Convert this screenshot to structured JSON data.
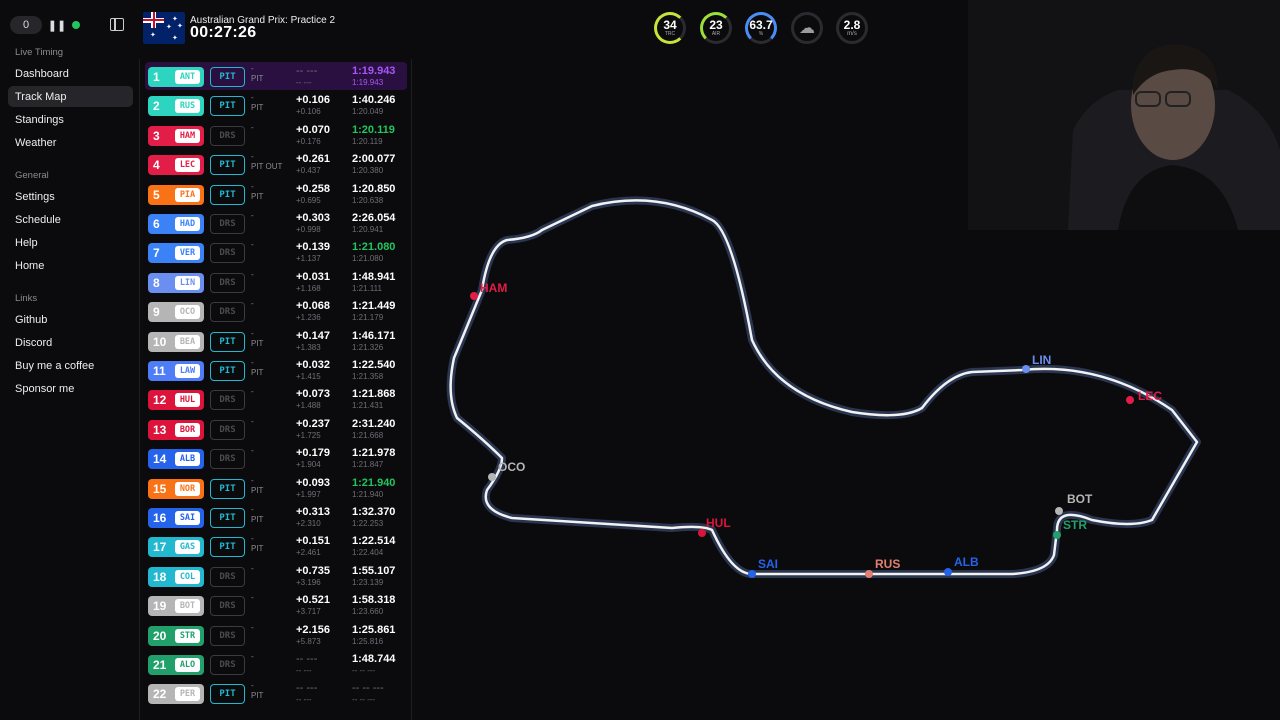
{
  "app": {
    "counter": "0",
    "colors": {
      "accent_purple": "#a855f7",
      "fastest_green": "#22c55e",
      "pit_cyan": "#22b8cf",
      "live_green": "#22c55e"
    }
  },
  "sidebar": {
    "sections": [
      {
        "heading": "Live Timing",
        "items": [
          "Dashboard",
          "Track Map",
          "Standings",
          "Weather"
        ]
      },
      {
        "heading": "General",
        "items": [
          "Settings",
          "Schedule",
          "Help",
          "Home"
        ]
      },
      {
        "heading": "Links",
        "items": [
          "Github",
          "Discord",
          "Buy me a coffee",
          "Sponsor me"
        ]
      }
    ],
    "active_item": "Track Map"
  },
  "header": {
    "session_title": "Australian Grand Prix: Practice 2",
    "clock": "00:27:26",
    "flag_icon": "australia-flag-icon"
  },
  "weather": {
    "track_temp": {
      "value": "34",
      "label": "TRC",
      "color": "#c6e33b"
    },
    "air_temp": {
      "value": "23",
      "label": "AIR",
      "color": "#9be03b"
    },
    "humidity": {
      "value": "63.7",
      "label": "%",
      "color": "#4b8df7"
    },
    "rain_icon": "rain-cloud-icon",
    "wind": {
      "value": "2.8",
      "label": "m/s"
    }
  },
  "drivers": [
    {
      "pos": "1",
      "code": "ANT",
      "color": "#2dd4bf",
      "drs": "PIT",
      "status": "-",
      "status2": "PIT",
      "gap": "-- ---",
      "interval": "-- ---",
      "lap": "1:19.943",
      "prev": "1:19.943",
      "lap_color": "purple",
      "fastest": true
    },
    {
      "pos": "2",
      "code": "RUS",
      "color": "#2dd4bf",
      "drs": "PIT",
      "status": "-",
      "status2": "PIT",
      "gap": "+0.106",
      "interval": "+0.106",
      "lap": "1:40.246",
      "prev": "1:20.049",
      "lap_color": "white"
    },
    {
      "pos": "3",
      "code": "HAM",
      "color": "#e11d48",
      "drs": "DRS",
      "status": "-",
      "status2": "-",
      "gap": "+0.070",
      "interval": "+0.176",
      "lap": "1:20.119",
      "prev": "1:20.119",
      "lap_color": "green"
    },
    {
      "pos": "4",
      "code": "LEC",
      "color": "#e11d48",
      "drs": "PIT",
      "status": "-",
      "status2": "PIT OUT",
      "gap": "+0.261",
      "interval": "+0.437",
      "lap": "2:00.077",
      "prev": "1:20.380",
      "lap_color": "white"
    },
    {
      "pos": "5",
      "code": "PIA",
      "color": "#f97316",
      "drs": "PIT",
      "status": "-",
      "status2": "PIT",
      "gap": "+0.258",
      "interval": "+0.695",
      "lap": "1:20.850",
      "prev": "1:20.638",
      "lap_color": "white"
    },
    {
      "pos": "6",
      "code": "HAD",
      "color": "#3b82f6",
      "drs": "DRS",
      "status": "-",
      "status2": "-",
      "gap": "+0.303",
      "interval": "+0.998",
      "lap": "2:26.054",
      "prev": "1:20.941",
      "lap_color": "white"
    },
    {
      "pos": "7",
      "code": "VER",
      "color": "#3b82f6",
      "drs": "DRS",
      "status": "-",
      "status2": "-",
      "gap": "+0.139",
      "interval": "+1.137",
      "lap": "1:21.080",
      "prev": "1:21.080",
      "lap_color": "green"
    },
    {
      "pos": "8",
      "code": "LIN",
      "color": "#6b8ff0",
      "drs": "DRS",
      "status": "-",
      "status2": "-",
      "gap": "+0.031",
      "interval": "+1.168",
      "lap": "1:48.941",
      "prev": "1:21.111",
      "lap_color": "white"
    },
    {
      "pos": "9",
      "code": "OCO",
      "color": "#b5b5b5",
      "drs": "DRS",
      "status": "-",
      "status2": "-",
      "gap": "+0.068",
      "interval": "+1.236",
      "lap": "1:21.449",
      "prev": "1:21.179",
      "lap_color": "white"
    },
    {
      "pos": "10",
      "code": "BEA",
      "color": "#b5b5b5",
      "drs": "PIT",
      "status": "-",
      "status2": "PIT",
      "gap": "+0.147",
      "interval": "+1.383",
      "lap": "1:46.171",
      "prev": "1:21.326",
      "lap_color": "white"
    },
    {
      "pos": "11",
      "code": "LAW",
      "color": "#4f7cf7",
      "drs": "PIT",
      "status": "-",
      "status2": "PIT",
      "gap": "+0.032",
      "interval": "+1.415",
      "lap": "1:22.540",
      "prev": "1:21.358",
      "lap_color": "white"
    },
    {
      "pos": "12",
      "code": "HUL",
      "color": "#dc143c",
      "drs": "DRS",
      "status": "-",
      "status2": "-",
      "gap": "+0.073",
      "interval": "+1.488",
      "lap": "1:21.868",
      "prev": "1:21.431",
      "lap_color": "white"
    },
    {
      "pos": "13",
      "code": "BOR",
      "color": "#dc143c",
      "drs": "DRS",
      "status": "-",
      "status2": "-",
      "gap": "+0.237",
      "interval": "+1.725",
      "lap": "2:31.240",
      "prev": "1:21.668",
      "lap_color": "white"
    },
    {
      "pos": "14",
      "code": "ALB",
      "color": "#2563eb",
      "drs": "DRS",
      "status": "-",
      "status2": "-",
      "gap": "+0.179",
      "interval": "+1.904",
      "lap": "1:21.978",
      "prev": "1:21.847",
      "lap_color": "white"
    },
    {
      "pos": "15",
      "code": "NOR",
      "color": "#f97316",
      "drs": "PIT",
      "status": "-",
      "status2": "PIT",
      "gap": "+0.093",
      "interval": "+1.997",
      "lap": "1:21.940",
      "prev": "1:21.940",
      "lap_color": "green"
    },
    {
      "pos": "16",
      "code": "SAI",
      "color": "#2563eb",
      "drs": "PIT",
      "status": "-",
      "status2": "PIT",
      "gap": "+0.313",
      "interval": "+2.310",
      "lap": "1:32.370",
      "prev": "1:22.253",
      "lap_color": "white"
    },
    {
      "pos": "17",
      "code": "GAS",
      "color": "#22b8cf",
      "drs": "PIT",
      "status": "-",
      "status2": "PIT",
      "gap": "+0.151",
      "interval": "+2.461",
      "lap": "1:22.514",
      "prev": "1:22.404",
      "lap_color": "white"
    },
    {
      "pos": "18",
      "code": "COL",
      "color": "#22b8cf",
      "drs": "DRS",
      "status": "-",
      "status2": "-",
      "gap": "+0.735",
      "interval": "+3.196",
      "lap": "1:55.107",
      "prev": "1:23.139",
      "lap_color": "white"
    },
    {
      "pos": "19",
      "code": "BOT",
      "color": "#b5b5b5",
      "drs": "DRS",
      "status": "-",
      "status2": "-",
      "gap": "+0.521",
      "interval": "+3.717",
      "lap": "1:58.318",
      "prev": "1:23.660",
      "lap_color": "white"
    },
    {
      "pos": "20",
      "code": "STR",
      "color": "#22a06b",
      "drs": "DRS",
      "status": "-",
      "status2": "-",
      "gap": "+2.156",
      "interval": "+5.873",
      "lap": "1:25.861",
      "prev": "1:25.816",
      "lap_color": "white"
    },
    {
      "pos": "21",
      "code": "ALO",
      "color": "#22a06b",
      "drs": "DRS",
      "status": "-",
      "status2": "-",
      "gap": "-- ---",
      "interval": "-- ---",
      "lap": "1:48.744",
      "prev": "-- -- ---",
      "lap_color": "white"
    },
    {
      "pos": "22",
      "code": "PER",
      "color": "#b5b5b5",
      "drs": "PIT",
      "status": "-",
      "status2": "PIT",
      "gap": "-- ---",
      "interval": "-- ---",
      "lap": "-- -- ---",
      "prev": "-- -- ---",
      "lap_color": "dim"
    }
  ],
  "track_markers": [
    {
      "code": "HAM",
      "color": "#e11d48"
    },
    {
      "code": "LIN",
      "color": "#6b8ff0"
    },
    {
      "code": "LEC",
      "color": "#e11d48"
    },
    {
      "code": "OCO",
      "color": "#b5b5b5"
    },
    {
      "code": "HUL",
      "color": "#dc143c"
    },
    {
      "code": "BOT",
      "color": "#b5b5b5"
    },
    {
      "code": "STR",
      "color": "#22a06b"
    },
    {
      "code": "SAI",
      "color": "#2563eb"
    },
    {
      "code": "RUS",
      "color": "#e08070"
    },
    {
      "code": "ALB",
      "color": "#2563eb"
    }
  ]
}
